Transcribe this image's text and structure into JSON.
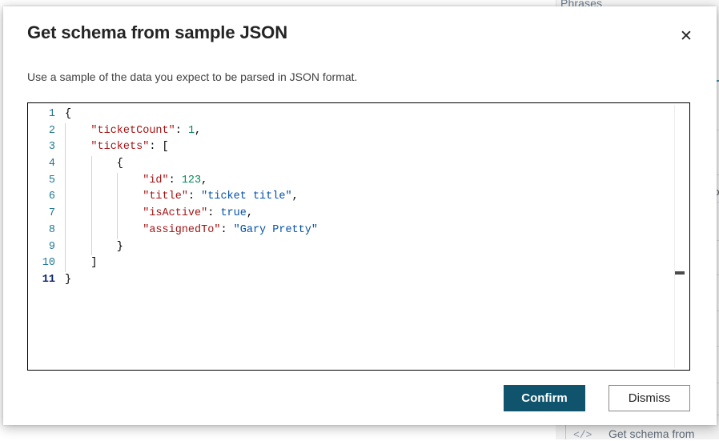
{
  "background": {
    "header_label": "Phrases",
    "chip_label": "ap",
    "footer_icon": "</>",
    "footer_label": "Get schema from",
    "accent_color": "#4a8ca8"
  },
  "dialog": {
    "title": "Get schema from sample JSON",
    "subtitle": "Use a sample of the data you expect to be parsed in JSON format.",
    "close_icon": "✕",
    "close_label": "Close",
    "primary_button": "Confirm",
    "secondary_button": "Dismiss",
    "primary_color": "#0f546c"
  },
  "editor": {
    "current_line": 11,
    "lines": [
      {
        "number": "1",
        "indent_guides": [],
        "tokens": [
          {
            "t": "{",
            "c": "p"
          }
        ]
      },
      {
        "number": "2",
        "indent_guides": [
          0
        ],
        "tokens": [
          {
            "t": "    ",
            "c": "p"
          },
          {
            "t": "\"ticketCount\"",
            "c": "k"
          },
          {
            "t": ": ",
            "c": "p"
          },
          {
            "t": "1",
            "c": "n"
          },
          {
            "t": ",",
            "c": "p"
          }
        ]
      },
      {
        "number": "3",
        "indent_guides": [
          0
        ],
        "tokens": [
          {
            "t": "    ",
            "c": "p"
          },
          {
            "t": "\"tickets\"",
            "c": "k"
          },
          {
            "t": ": [",
            "c": "p"
          }
        ]
      },
      {
        "number": "4",
        "indent_guides": [
          0,
          1
        ],
        "tokens": [
          {
            "t": "        {",
            "c": "p"
          }
        ]
      },
      {
        "number": "5",
        "indent_guides": [
          0,
          1,
          2
        ],
        "tokens": [
          {
            "t": "            ",
            "c": "p"
          },
          {
            "t": "\"id\"",
            "c": "k"
          },
          {
            "t": ": ",
            "c": "p"
          },
          {
            "t": "123",
            "c": "n"
          },
          {
            "t": ",",
            "c": "p"
          }
        ]
      },
      {
        "number": "6",
        "indent_guides": [
          0,
          1,
          2
        ],
        "tokens": [
          {
            "t": "            ",
            "c": "p"
          },
          {
            "t": "\"title\"",
            "c": "k"
          },
          {
            "t": ": ",
            "c": "p"
          },
          {
            "t": "\"ticket title\"",
            "c": "s"
          },
          {
            "t": ",",
            "c": "p"
          }
        ]
      },
      {
        "number": "7",
        "indent_guides": [
          0,
          1,
          2
        ],
        "tokens": [
          {
            "t": "            ",
            "c": "p"
          },
          {
            "t": "\"isActive\"",
            "c": "k"
          },
          {
            "t": ": ",
            "c": "p"
          },
          {
            "t": "true",
            "c": "b"
          },
          {
            "t": ",",
            "c": "p"
          }
        ]
      },
      {
        "number": "8",
        "indent_guides": [
          0,
          1,
          2
        ],
        "tokens": [
          {
            "t": "            ",
            "c": "p"
          },
          {
            "t": "\"assignedTo\"",
            "c": "k"
          },
          {
            "t": ": ",
            "c": "p"
          },
          {
            "t": "\"Gary Pretty\"",
            "c": "s"
          }
        ]
      },
      {
        "number": "9",
        "indent_guides": [
          0,
          1
        ],
        "tokens": [
          {
            "t": "        }",
            "c": "p"
          }
        ]
      },
      {
        "number": "10",
        "indent_guides": [
          0
        ],
        "tokens": [
          {
            "t": "    ]",
            "c": "p"
          }
        ]
      },
      {
        "number": "11",
        "indent_guides": [],
        "tokens": [
          {
            "t": "}",
            "c": "p"
          }
        ]
      }
    ]
  }
}
